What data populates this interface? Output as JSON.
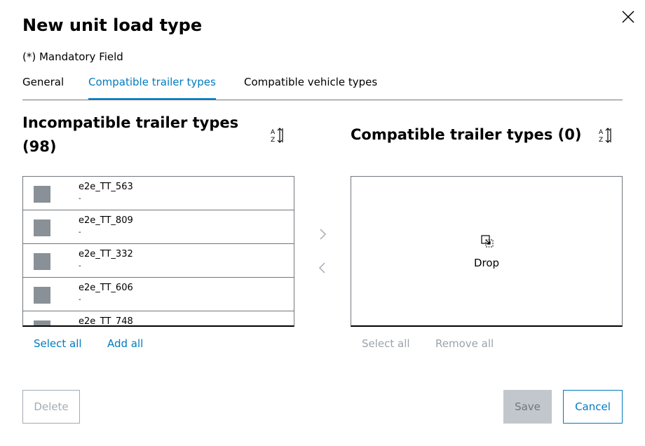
{
  "dialog": {
    "title": "New unit load type",
    "mandatory_note": "(*) Mandatory Field"
  },
  "tabs": [
    {
      "label": "General",
      "active": false
    },
    {
      "label": "Compatible trailer types",
      "active": true
    },
    {
      "label": "Compatible vehicle types",
      "active": false
    }
  ],
  "incompatible": {
    "title": "Incompatible trailer types (98)",
    "items": [
      {
        "name": "e2e_TT_563",
        "sub": "-"
      },
      {
        "name": "e2e_TT_809",
        "sub": "-"
      },
      {
        "name": "e2e_TT_332",
        "sub": "-"
      },
      {
        "name": "e2e_TT_606",
        "sub": "-"
      },
      {
        "name": "e2e_TT_748",
        "sub": "-"
      }
    ],
    "select_all": "Select all",
    "add_all": "Add all"
  },
  "compatible": {
    "title": "Compatible trailer types (0)",
    "drop_label": "Drop",
    "select_all": "Select all",
    "remove_all": "Remove all"
  },
  "footer": {
    "delete_label": "Delete",
    "save_label": "Save",
    "cancel_label": "Cancel"
  },
  "colors": {
    "accent": "#007bc0",
    "disabled": "#9ca3a9",
    "checkbox": "#8a9097",
    "save_bg": "#c1c7cc"
  },
  "icons": {
    "close": "close-icon",
    "sort": "sort-az-icon",
    "move_right": "chevron-right-icon",
    "move_left": "chevron-left-icon",
    "drop": "drop-icon"
  }
}
